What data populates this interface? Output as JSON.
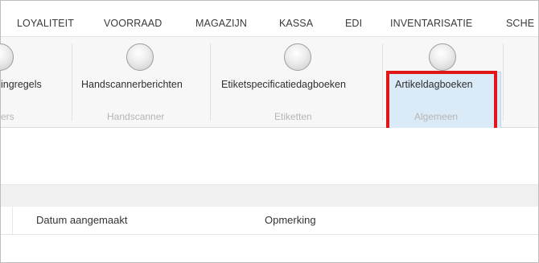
{
  "tabs": [
    "LOYALITEIT",
    "VOORRAAD",
    "MAGAZIJN",
    "KASSA",
    "EDI",
    "INVENTARISATIE",
    "SCHE"
  ],
  "ribbon": {
    "buttons": [
      {
        "label": "ingregels",
        "icon": "circle-icon"
      },
      {
        "label": "Handscannerberichten",
        "icon": "circle-icon"
      },
      {
        "label": "Etiketspecificatiedagboeken",
        "icon": "circle-icon"
      },
      {
        "label": "Artikeldagboeken",
        "icon": "circle-icon"
      }
    ],
    "groups": [
      "ers",
      "Handscanner",
      "Etiketten",
      "Algemeen"
    ]
  },
  "grid": {
    "columns": [
      "Datum aangemaakt",
      "Opmerking"
    ]
  },
  "colors": {
    "highlight": "#dbeaf7",
    "annotation": "#e11616"
  }
}
